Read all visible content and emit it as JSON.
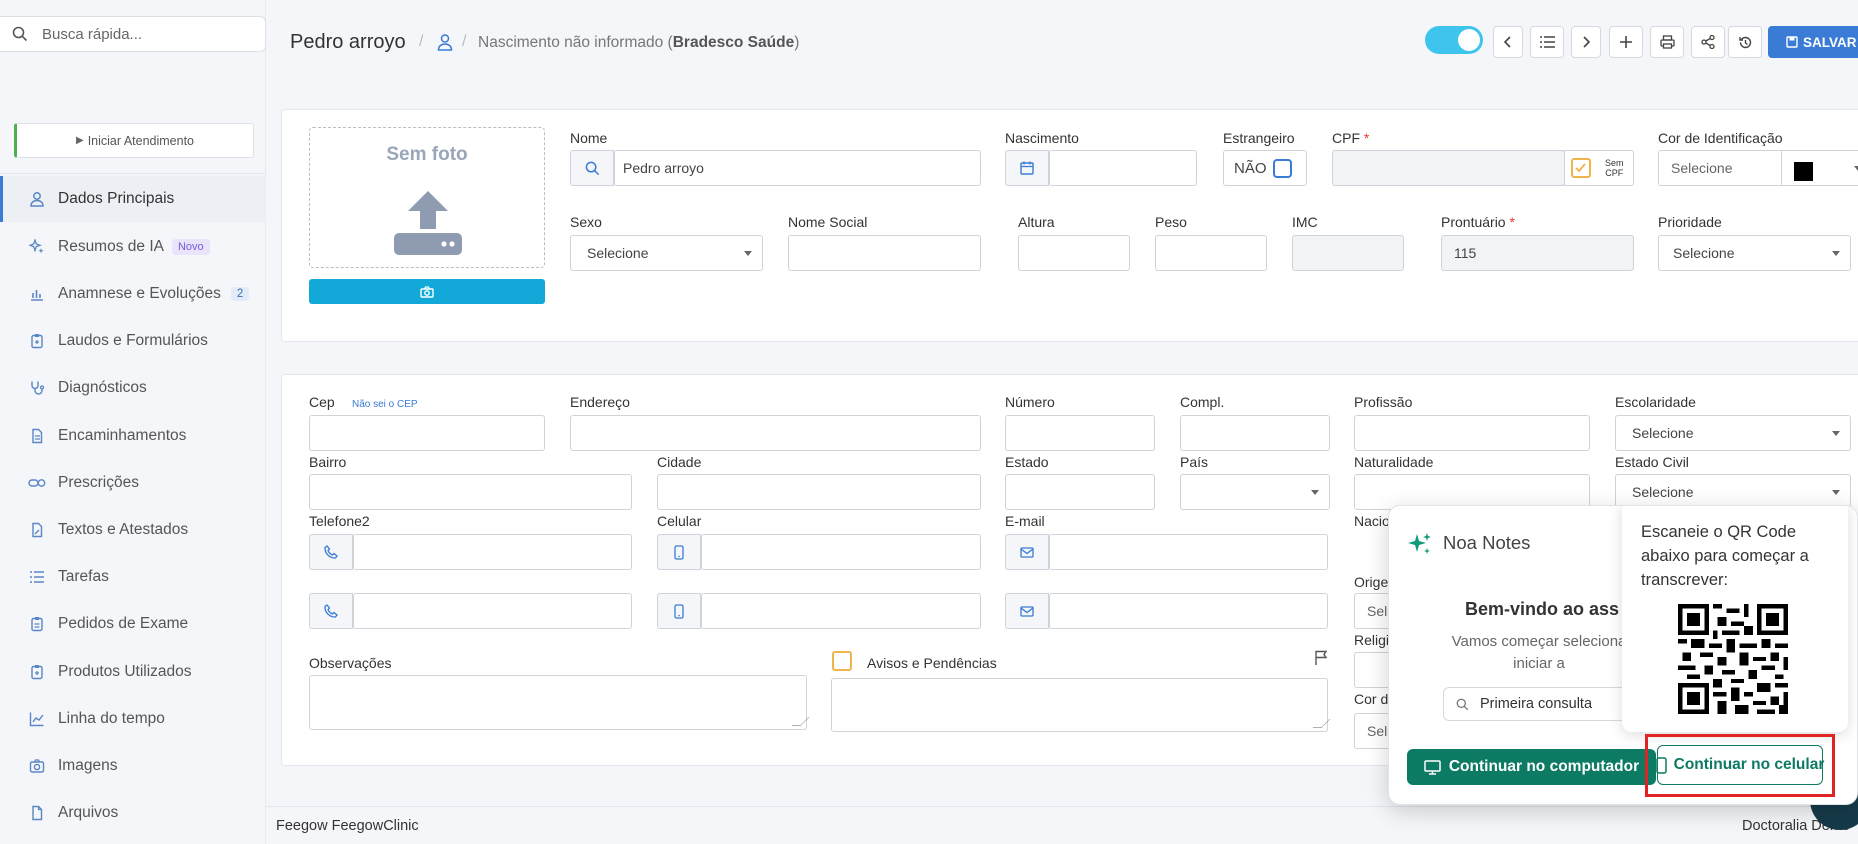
{
  "search": {
    "placeholder": "Busca rápida..."
  },
  "sidebar": {
    "start_button": "Iniciar Atendimento",
    "items": [
      {
        "label": "Dados Principais",
        "icon": "user-icon"
      },
      {
        "label": "Resumos de IA",
        "icon": "sparkle-icon",
        "badge": "Novo"
      },
      {
        "label": "Anamnese e Evoluções",
        "icon": "bar-chart-icon",
        "count": "2"
      },
      {
        "label": "Laudos e Formulários",
        "icon": "clipboard-icon"
      },
      {
        "label": "Diagnósticos",
        "icon": "stethoscope-icon"
      },
      {
        "label": "Encaminhamentos",
        "icon": "document-icon"
      },
      {
        "label": "Prescrições",
        "icon": "pills-icon"
      },
      {
        "label": "Textos e Atestados",
        "icon": "edit-document-icon"
      },
      {
        "label": "Tarefas",
        "icon": "list-icon"
      },
      {
        "label": "Pedidos de Exame",
        "icon": "clipboard-list-icon"
      },
      {
        "label": "Produtos Utilizados",
        "icon": "box-icon"
      },
      {
        "label": "Linha do tempo",
        "icon": "line-chart-icon"
      },
      {
        "label": "Imagens",
        "icon": "camera-icon"
      },
      {
        "label": "Arquivos",
        "icon": "file-icon"
      }
    ]
  },
  "header": {
    "patient_name": "Pedro arroyo",
    "birth_text": "Nascimento não informado (",
    "insurance": "Bradesco Saúde",
    "birth_close": ")",
    "save_label": "SALVAR"
  },
  "photo": {
    "no_photo": "Sem foto"
  },
  "fields": {
    "nome_label": "Nome",
    "nome_value": "Pedro arroyo",
    "nascimento_label": "Nascimento",
    "estrangeiro_label": "Estrangeiro",
    "estrangeiro_value": "NÃO",
    "cpf_label": "CPF",
    "sem_cpf_1": "Sem",
    "sem_cpf_2": "CPF",
    "cor_label": "Cor de Identificação",
    "cor_value": "Selecione",
    "sexo_label": "Sexo",
    "sexo_value": "Selecione",
    "nome_social_label": "Nome Social",
    "altura_label": "Altura",
    "peso_label": "Peso",
    "imc_label": "IMC",
    "prontuario_label": "Prontuário",
    "prontuario_value": "115",
    "prioridade_label": "Prioridade",
    "prioridade_value": "Selecione",
    "cep_label": "Cep",
    "nao_sei_cep": "Não sei o CEP",
    "endereco_label": "Endereço",
    "numero_label": "Número",
    "compl_label": "Compl.",
    "profissao_label": "Profissão",
    "escolaridade_label": "Escolaridade",
    "escolaridade_value": "Selecione",
    "bairro_label": "Bairro",
    "cidade_label": "Cidade",
    "estado_label": "Estado",
    "pais_label": "País",
    "naturalidade_label": "Naturalidade",
    "estado_civil_label": "Estado Civil",
    "estado_civil_value": "Selecione",
    "telefone2_label": "Telefone2",
    "celular_label": "Celular",
    "email_label": "E-mail",
    "nacio_label": "Nacio",
    "orige_label": "Orige",
    "sele_value": "Sele",
    "religi_label": "Religi",
    "cord_label": "Cor d",
    "observacoes_label": "Observações",
    "avisos_label": "Avisos e Pendências"
  },
  "noa": {
    "title": "Noa Notes",
    "welcome": "Bem-vindo ao ass",
    "sub_line1": "Vamos começar seleciona",
    "sub_line2": "iniciar a",
    "field_value": "Primeira consulta",
    "qr_text": "Escaneie o QR Code abaixo para começar a transcrever:",
    "btn_computer": "Continuar no computador",
    "btn_celular": "Continuar no celular"
  },
  "footer": {
    "left": "Feegow FeegowClinic",
    "right": "Doctoralia Demo"
  },
  "colors": {
    "primary": "#3a7bd5",
    "toggle": "#3fc4ee",
    "noa_green": "#0d7a63",
    "highlight": "#e02424"
  }
}
